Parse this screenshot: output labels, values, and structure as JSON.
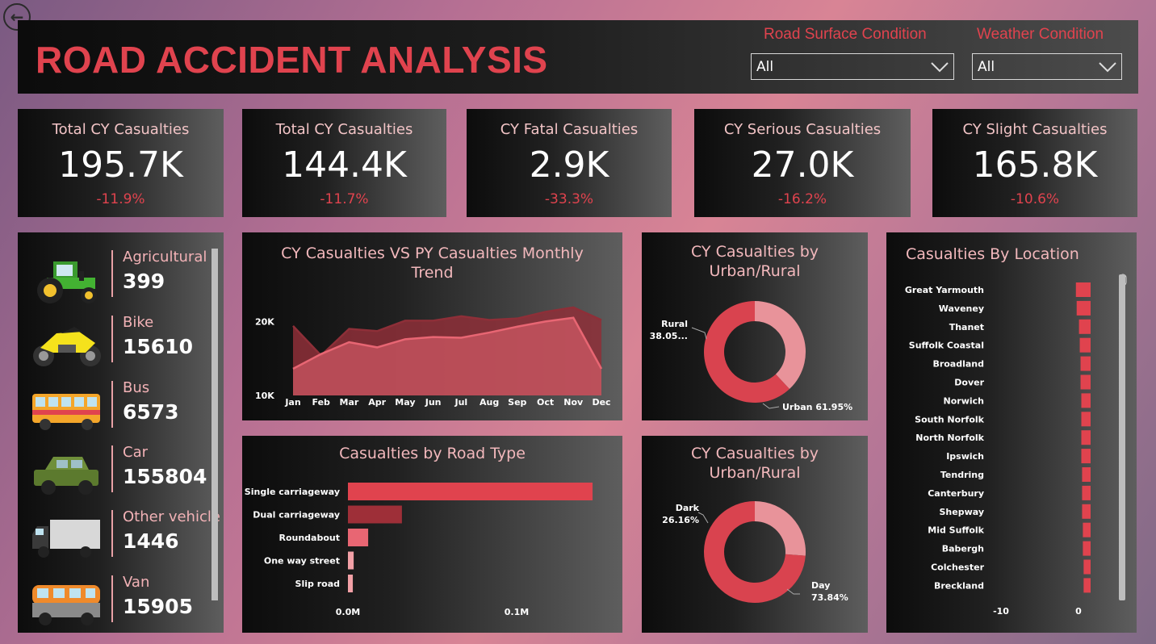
{
  "header": {
    "title": "ROAD ACCIDENT ANALYSIS",
    "filters": [
      {
        "label": "Road Surface Condition",
        "value": "All"
      },
      {
        "label": "Weather Condition",
        "value": "All"
      }
    ]
  },
  "kpis": [
    {
      "title": "Total CY Casualties",
      "value": "195.7K",
      "delta": "-11.9%"
    },
    {
      "title": "Total CY Casualties",
      "value": "144.4K",
      "delta": "-11.7%"
    },
    {
      "title": "CY Fatal Casualties",
      "value": "2.9K",
      "delta": "-33.3%"
    },
    {
      "title": "CY Serious Casualties",
      "value": "27.0K",
      "delta": "-16.2%"
    },
    {
      "title": "CY Slight Casualties",
      "value": "165.8K",
      "delta": "-10.6%"
    }
  ],
  "vehicles": [
    {
      "name": "Agricultural",
      "value": "399",
      "icon": "tractor-icon"
    },
    {
      "name": "Bike",
      "value": "15610",
      "icon": "motorbike-icon"
    },
    {
      "name": "Bus",
      "value": "6573",
      "icon": "bus-icon"
    },
    {
      "name": "Car",
      "value": "155804",
      "icon": "car-icon"
    },
    {
      "name": "Other vehicle",
      "value": "1446",
      "icon": "truck-icon"
    },
    {
      "name": "Van",
      "value": "15905",
      "icon": "van-icon"
    }
  ],
  "colors": {
    "accent": "#e0434e",
    "cy_series": "#8e2f38",
    "py_series": "#e86673",
    "donut_light": "#e8939a",
    "donut_dark": "#d9434f"
  },
  "chart_data": [
    {
      "type": "area",
      "title": "CY Casualties VS PY Casualties Monthly Trend",
      "categories": [
        "Jan",
        "Feb",
        "Mar",
        "Apr",
        "May",
        "Jun",
        "Jul",
        "Aug",
        "Sep",
        "Oct",
        "Nov",
        "Dec"
      ],
      "y_ticks": [
        "20K",
        "10K"
      ],
      "ylim": [
        10000,
        22000
      ],
      "series": [
        {
          "values": [
            19400,
            15400,
            19000,
            18700,
            20100,
            20100,
            20700,
            20200,
            20400,
            21300,
            21900,
            20200
          ]
        },
        {
          "values": [
            13600,
            15600,
            17200,
            16500,
            17600,
            17900,
            17800,
            18500,
            19300,
            20000,
            20500,
            13600
          ]
        }
      ]
    },
    {
      "type": "bar",
      "orientation": "horizontal",
      "title": "Casualties by Road Type",
      "categories": [
        "Single carriageway",
        "Dual carriageway",
        "Roundabout",
        "One way street",
        "Slip road"
      ],
      "values": [
        145000,
        32000,
        12000,
        3400,
        2900
      ],
      "x_ticks": [
        "0.0M",
        "0.1M"
      ],
      "xlim": [
        0,
        100000
      ]
    },
    {
      "type": "pie",
      "title": "CY Casualties by Urban/Rural",
      "slices": [
        {
          "label": "Rural",
          "value_label": "38.05...",
          "value": 38.05
        },
        {
          "label": "Urban",
          "value_label": "61.95%",
          "value": 61.95
        }
      ]
    },
    {
      "type": "pie",
      "title": "CY Casualties by Urban/Rural",
      "slices": [
        {
          "label": "Dark",
          "value_label": "26.16%",
          "value": 26.16
        },
        {
          "label": "Day",
          "value_label": "73.84%",
          "value": 73.84
        }
      ]
    },
    {
      "type": "bar",
      "orientation": "horizontal",
      "title": "Casualties By Location",
      "categories": [
        "Great Yarmouth",
        "Waveney",
        "Thanet",
        "Suffolk Coastal",
        "Broadland",
        "Dover",
        "Norwich",
        "South Norfolk",
        "North Norfolk",
        "Ipswich",
        "Tendring",
        "Canterbury",
        "Shepway",
        "Mid Suffolk",
        "Babergh",
        "Colchester",
        "Breckland"
      ],
      "values": [
        -1.9,
        -1.8,
        -1.5,
        -1.4,
        -1.3,
        -1.3,
        -1.2,
        -1.2,
        -1.2,
        -1.2,
        -1.1,
        -1.1,
        -1.1,
        -1.0,
        -1.0,
        -0.9,
        -0.9
      ],
      "x_ticks": [
        "-10",
        "0"
      ],
      "xlim": [
        -10,
        0
      ]
    }
  ]
}
